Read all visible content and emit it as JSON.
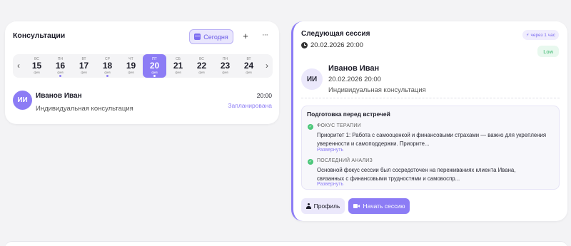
{
  "consultations": {
    "title": "Консультации",
    "today_label": "Сегодня",
    "add_label": "+",
    "more_label": "···",
    "prev_label": "‹",
    "next_label": "›",
    "days": [
      {
        "dow": "ВС",
        "num": "15",
        "mon": "фев",
        "active": false,
        "dot": false
      },
      {
        "dow": "ПН",
        "num": "16",
        "mon": "фев",
        "active": false,
        "dot": true
      },
      {
        "dow": "ВТ",
        "num": "17",
        "mon": "фев",
        "active": false,
        "dot": false
      },
      {
        "dow": "СР",
        "num": "18",
        "mon": "фев",
        "active": false,
        "dot": true
      },
      {
        "dow": "ЧТ",
        "num": "19",
        "mon": "фев",
        "active": false,
        "dot": false
      },
      {
        "dow": "ПТ",
        "num": "20",
        "mon": "фев",
        "active": true,
        "dot": true
      },
      {
        "dow": "СБ",
        "num": "21",
        "mon": "фев",
        "active": false,
        "dot": false
      },
      {
        "dow": "ВС",
        "num": "22",
        "mon": "фев",
        "active": false,
        "dot": false
      },
      {
        "dow": "ПН",
        "num": "23",
        "mon": "фев",
        "active": false,
        "dot": false
      },
      {
        "dow": "ВТ",
        "num": "24",
        "mon": "фев",
        "active": false,
        "dot": false
      }
    ],
    "appointment": {
      "initials": "ИИ",
      "name": "Иванов Иван",
      "type": "Индивидуальная консультация",
      "time": "20:00",
      "status": "Запланирована"
    }
  },
  "next_session": {
    "title": "Следующая сессия",
    "datetime": "20.02.2026 20:00",
    "badge_in": "через 1 час",
    "priority": "Low",
    "initials": "ИИ",
    "name": "Иванов Иван",
    "date": "20.02.2026 20:00",
    "type": "Индивидуальная консультация",
    "prep": {
      "title": "Подготовка перед встречей",
      "sections": [
        {
          "label": "ФОКУС ТЕРАПИИ",
          "line1": "Приоритет 1: Работа с самооценкой и финансовыми страхами — важно для укрепления",
          "line2": "уверенности и самоподдержки. Приорите...",
          "link": "Развернуть"
        },
        {
          "label": "ПОСЛЕДНИЙ АНАЛИЗ",
          "line1": "Основной фокус сессии был сосредоточен на переживаниях клиента Ивана,",
          "line2": "связанных с финансовыми трудностями и самовоспр...",
          "link": "Развернуть"
        }
      ]
    },
    "profile_label": "Профиль",
    "start_label": "Начать сессию"
  },
  "colors": {
    "accent": "#8c7cf5",
    "accent_light": "#ebe8fb",
    "success": "#4cc77a",
    "background": "#f3f3f5"
  }
}
